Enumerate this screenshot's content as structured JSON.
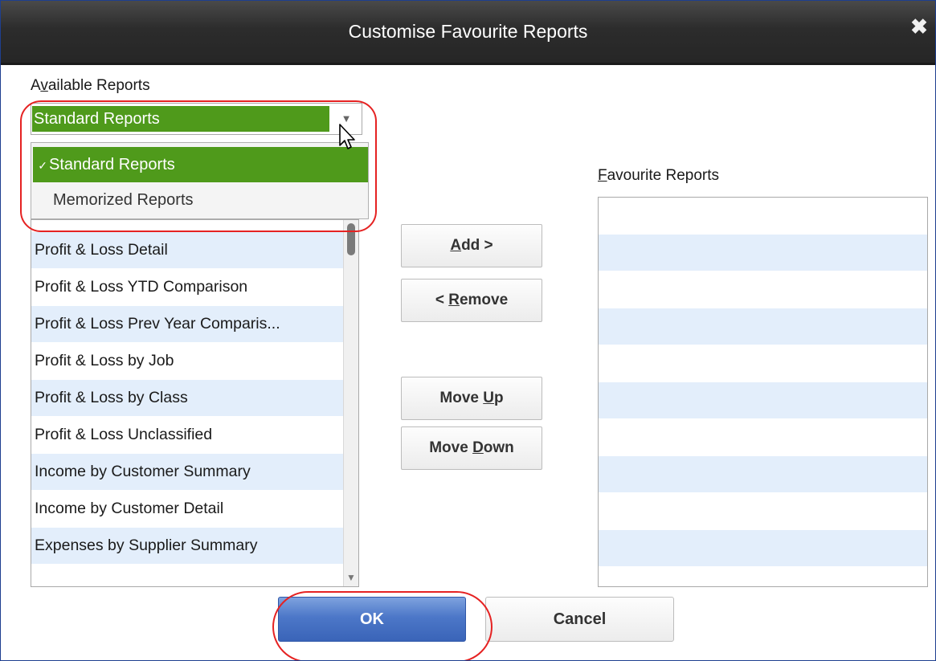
{
  "dialog": {
    "title": "Customise Favourite Reports",
    "close_icon": "close-icon"
  },
  "available": {
    "label": "Available Reports",
    "combo_value": "Standard Reports",
    "dropdown_options": [
      {
        "label": "Standard Reports",
        "selected": true
      },
      {
        "label": "Memorized Reports",
        "selected": false
      }
    ],
    "reports": [
      "Profit & Loss Detail",
      "Profit & Loss YTD Comparison",
      "Profit & Loss Prev Year Comparis...",
      "Profit & Loss by Job",
      "Profit & Loss by Class",
      "Profit & Loss Unclassified",
      "Income by Customer Summary",
      "Income by Customer Detail",
      "Expenses by Supplier Summary"
    ]
  },
  "favourites": {
    "label": "Favourite Reports",
    "reports": []
  },
  "buttons": {
    "add": "Add >",
    "remove": "< Remove",
    "move_up": "Move Up",
    "move_down": "Move Down",
    "ok": "OK",
    "cancel": "Cancel"
  },
  "colors": {
    "selection_green": "#4f9a1b",
    "row_stripe": "#e3eefb",
    "annotation_red": "#e52222",
    "ok_blue": "#4c77c8"
  }
}
